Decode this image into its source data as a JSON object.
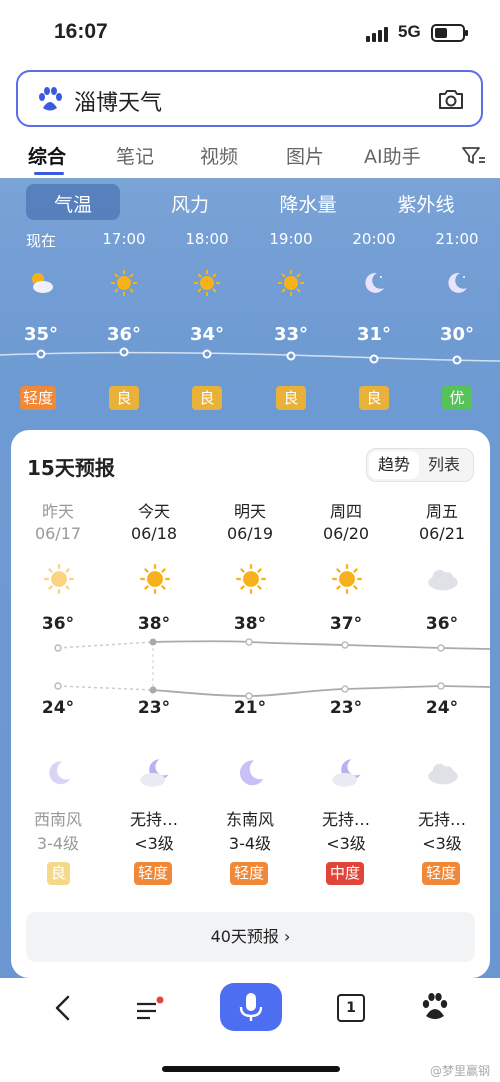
{
  "status": {
    "time": "16:07",
    "network": "5G"
  },
  "search": {
    "query": "淄博天气"
  },
  "tabs": [
    "综合",
    "笔记",
    "视频",
    "图片",
    "AI助手"
  ],
  "subtabs": [
    "气温",
    "风力",
    "降水量",
    "紫外线"
  ],
  "hourly": [
    {
      "time": "现在",
      "icon": "partly-cloudy-day-icon",
      "temp": "35°",
      "aq": "轻度",
      "aq_color": "#f0883a"
    },
    {
      "time": "17:00",
      "icon": "sun-icon",
      "temp": "36°",
      "aq": "良",
      "aq_color": "#e8b23a"
    },
    {
      "time": "18:00",
      "icon": "sun-icon",
      "temp": "34°",
      "aq": "良",
      "aq_color": "#e8b23a"
    },
    {
      "time": "19:00",
      "icon": "sun-icon",
      "temp": "33°",
      "aq": "良",
      "aq_color": "#e8b23a"
    },
    {
      "time": "20:00",
      "icon": "moon-icon",
      "temp": "31°",
      "aq": "良",
      "aq_color": "#e8b23a"
    },
    {
      "time": "21:00",
      "icon": "moon-icon",
      "temp": "30°",
      "aq": "优",
      "aq_color": "#56c25a"
    }
  ],
  "forecast": {
    "title": "15天预报",
    "toggle": [
      "趋势",
      "列表"
    ],
    "days": [
      {
        "name": "昨天",
        "date": "06/17",
        "icon": "sun-icon",
        "high": "36°",
        "low": "24°",
        "night_icon": "moon-icon",
        "wind_dir": "西南风",
        "wind_level": "3-4级",
        "aq": "良",
        "aq_color": "#e8d27a",
        "past": true
      },
      {
        "name": "今天",
        "date": "06/18",
        "icon": "sun-icon",
        "high": "38°",
        "low": "23°",
        "night_icon": "cloudy-moon-icon",
        "wind_dir": "无持…",
        "wind_level": "<3级",
        "aq": "轻度",
        "aq_color": "#f0883a",
        "past": false
      },
      {
        "name": "明天",
        "date": "06/19",
        "icon": "sun-icon",
        "high": "38°",
        "low": "21°",
        "night_icon": "moon-icon",
        "wind_dir": "东南风",
        "wind_level": "3-4级",
        "aq": "轻度",
        "aq_color": "#f0883a",
        "past": false
      },
      {
        "name": "周四",
        "date": "06/20",
        "icon": "sun-icon",
        "high": "37°",
        "low": "23°",
        "night_icon": "cloudy-moon-icon",
        "wind_dir": "无持…",
        "wind_level": "<3级",
        "aq": "中度",
        "aq_color": "#e0453a",
        "past": false
      },
      {
        "name": "周五",
        "date": "06/21",
        "icon": "cloud-icon",
        "high": "36°",
        "low": "24°",
        "night_icon": "cloud-icon",
        "wind_dir": "无持…",
        "wind_level": "<3级",
        "aq": "轻度",
        "aq_color": "#f0883a",
        "past": false
      }
    ],
    "more": "40天预报 ›"
  },
  "bottom": {
    "tab_count": "1"
  },
  "watermark": "@梦里赢钢"
}
